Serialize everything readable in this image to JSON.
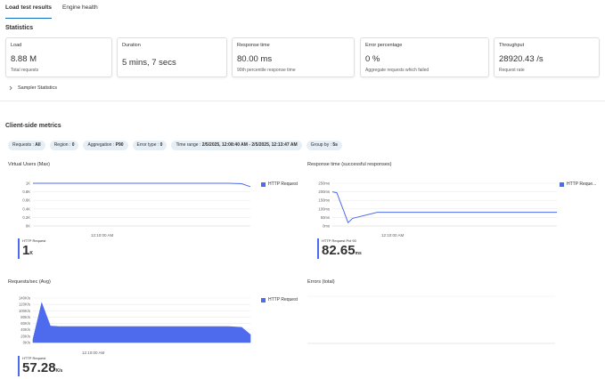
{
  "tabs": [
    {
      "label": "Load test results",
      "active": true
    },
    {
      "label": "Engine health",
      "active": false
    }
  ],
  "statistics_title": "Statistics",
  "cards": [
    {
      "title": "Load",
      "value": "8.88 M",
      "sub": "Total requests"
    },
    {
      "title": "Duration",
      "value": "5 mins, 7 secs",
      "sub": ""
    },
    {
      "title": "Response time",
      "value": "80.00 ms",
      "sub": "90th percentile response time"
    },
    {
      "title": "Error percentage",
      "value": "0 %",
      "sub": "Aggregate requests which failed"
    },
    {
      "title": "Throughput",
      "value": "28920.43 /s",
      "sub": "Request rate"
    }
  ],
  "sampler_label": "Sampler Statistics",
  "client_metrics_title": "Client-side metrics",
  "filters": [
    {
      "label": "Requests : ",
      "value": "All"
    },
    {
      "label": "Region : ",
      "value": "0"
    },
    {
      "label": "Aggregation : ",
      "value": "P90"
    },
    {
      "label": "Error type : ",
      "value": "0"
    },
    {
      "label": "Time range : ",
      "value": "2/5/2025, 12:08:40 AM - 2/5/2025, 12:13:47 AM"
    },
    {
      "label": "Group by : ",
      "value": "5s"
    }
  ],
  "colors": {
    "series": "#4f6bed",
    "accent": "#0f6cbd",
    "pill": "#e6eef6"
  },
  "charts": {
    "vu": {
      "title": "Virtual Users (Max)",
      "legend": "HTTP Request",
      "kpi_label": "HTTP Request",
      "kpi_value": "1",
      "kpi_unit": "K",
      "xtick": "12:10:00 AM",
      "ticks": [
        "1K",
        "0.8K",
        "0.6K",
        "0.4K",
        "0.2K",
        "0K"
      ]
    },
    "rt": {
      "title": "Response time (successful responses)",
      "legend": "HTTP Reque...",
      "kpi_label": "HTTP Request Pct 90",
      "kpi_value": "82.65",
      "kpi_unit": "ms",
      "xtick": "12:10:00 AM",
      "ticks": [
        "250ms",
        "200ms",
        "150ms",
        "100ms",
        "50ms",
        "0ms"
      ]
    },
    "rps": {
      "title": "Requests/sec (Avg)",
      "legend": "HTTP Request",
      "kpi_label": "HTTP Request",
      "kpi_value": "57.28",
      "kpi_unit": "K/s",
      "xtick": "12:10:00 AM",
      "ticks": [
        "140K/s",
        "120K/s",
        "100K/s",
        "80K/s",
        "60K/s",
        "40K/s",
        "20K/s",
        "0K/s"
      ]
    },
    "err": {
      "title": "Errors (total)"
    }
  },
  "chart_data": [
    {
      "type": "line",
      "title": "Virtual Users (Max)",
      "ylim": [
        0,
        1000
      ],
      "series": [
        {
          "name": "HTTP Request",
          "x": [
            0,
            0.05,
            0.3,
            0.6,
            0.9,
            0.96,
            1
          ],
          "y": [
            1000,
            1000,
            1000,
            1000,
            1000,
            990,
            920
          ]
        }
      ]
    },
    {
      "type": "line",
      "title": "Response time (successful responses)",
      "ylim": [
        0,
        250
      ],
      "series": [
        {
          "name": "HTTP Request Pct 90",
          "x": [
            0,
            0.02,
            0.05,
            0.07,
            0.09,
            0.2,
            0.5,
            0.8,
            1
          ],
          "y": [
            200,
            195,
            90,
            20,
            45,
            80,
            80,
            80,
            80
          ]
        }
      ]
    },
    {
      "type": "area",
      "title": "Requests/sec (Avg)",
      "ylim": [
        0,
        140000
      ],
      "series": [
        {
          "name": "HTTP Request",
          "x": [
            0,
            0.04,
            0.08,
            0.12,
            0.3,
            0.6,
            0.9,
            0.96,
            1
          ],
          "y": [
            10000,
            125000,
            52000,
            50000,
            50000,
            50000,
            50000,
            48000,
            25000
          ]
        }
      ]
    }
  ]
}
